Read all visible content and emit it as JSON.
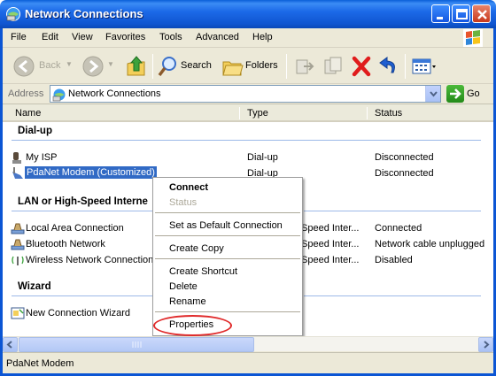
{
  "window": {
    "title": "Network Connections"
  },
  "menu": [
    "File",
    "Edit",
    "View",
    "Favorites",
    "Tools",
    "Advanced",
    "Help"
  ],
  "toolbar": {
    "back": "Back",
    "search": "Search",
    "folders": "Folders"
  },
  "address": {
    "label": "Address",
    "value": "Network Connections",
    "go": "Go"
  },
  "columns": {
    "name": "Name",
    "type": "Type",
    "status": "Status"
  },
  "groups": {
    "dialup": {
      "title": "Dial-up",
      "items": [
        {
          "name": "My ISP",
          "type": "Dial-up",
          "status": "Disconnected"
        },
        {
          "name": "PdaNet Modem (Customized)",
          "type": "Dial-up",
          "status": "Disconnected"
        }
      ]
    },
    "lan": {
      "title": "LAN or High-Speed Interne",
      "items": [
        {
          "name": "Local Area Connection",
          "type": "Speed Inter...",
          "status": "Connected"
        },
        {
          "name": "Bluetooth Network",
          "type": "Speed Inter...",
          "status": "Network cable unplugged"
        },
        {
          "name": "Wireless Network Connection",
          "type": "Speed Inter...",
          "status": "Disabled"
        }
      ]
    },
    "wizard": {
      "title": "Wizard",
      "items": [
        {
          "name": "New Connection Wizard"
        }
      ]
    }
  },
  "context_menu": {
    "connect": "Connect",
    "status": "Status",
    "set_default": "Set as Default Connection",
    "create_copy": "Create Copy",
    "create_shortcut": "Create Shortcut",
    "delete": "Delete",
    "rename": "Rename",
    "properties": "Properties"
  },
  "statusbar": {
    "text": "PdaNet Modem"
  },
  "colors": {
    "title_blue": "#0f55d0",
    "selection": "#316ac5",
    "highlight_ring": "#e02a2a"
  }
}
